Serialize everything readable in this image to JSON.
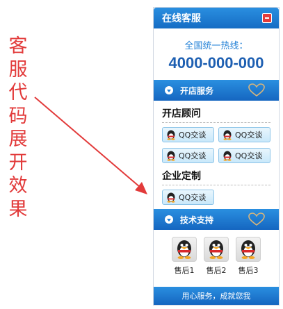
{
  "annotation": {
    "chars": [
      "客",
      "服",
      "代",
      "码",
      "展",
      "开",
      "效",
      "果"
    ],
    "color": "#e23a3a"
  },
  "panel": {
    "title": "在线客服",
    "hotline_label": "全国统一热线：",
    "hotline_number": "4000-000-000",
    "sections": {
      "shop_service": "开店服务",
      "tech_support": "技术支持"
    },
    "groups": {
      "consultant": {
        "title": "开店顾问",
        "buttons": [
          "QQ交谈",
          "QQ交谈",
          "QQ交谈",
          "QQ交谈"
        ]
      },
      "custom": {
        "title": "企业定制",
        "buttons": [
          "QQ交谈"
        ]
      }
    },
    "support": [
      {
        "label": "售后1"
      },
      {
        "label": "售后2"
      },
      {
        "label": "售后3"
      }
    ],
    "footer": "用心服务，成就您我",
    "icons": {
      "close": "close-icon",
      "chevron": "chevron-down-icon",
      "heart": "heart-icon",
      "qq": "qq-penguin-icon"
    },
    "colors": {
      "brand_blue": "#1f7fd6",
      "hotline_blue": "#1d5fb2",
      "close_red": "#e33b3b"
    }
  }
}
